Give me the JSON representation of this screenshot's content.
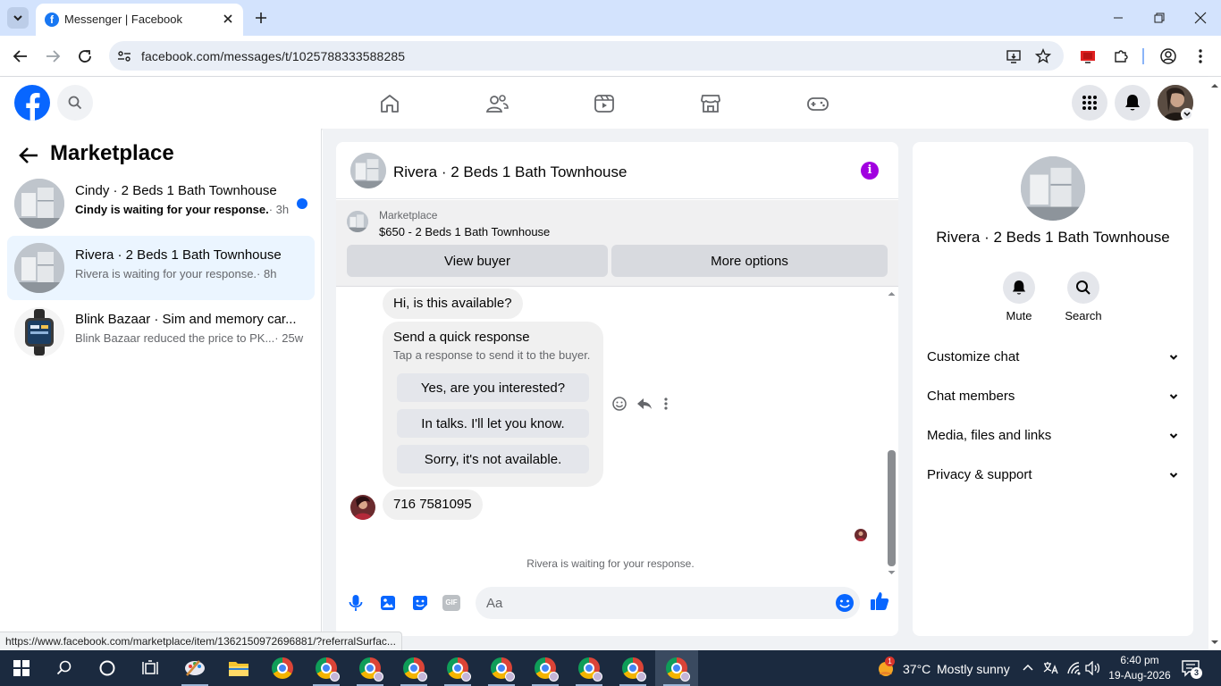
{
  "browser": {
    "tab_title": "Messenger | Facebook",
    "url": "facebook.com/messages/t/1025788333588285",
    "status_link": "https://www.facebook.com/marketplace/item/1362150972696881/?referralSurfac..."
  },
  "sidebar": {
    "title": "Marketplace",
    "conversations": [
      {
        "name": "Cindy · 2 Beds 1 Bath Townhouse",
        "snippet": "Cindy is waiting for your response.",
        "time": "· 3h",
        "unread": true
      },
      {
        "name": "Rivera · 2 Beds 1 Bath Townhouse",
        "snippet": "Rivera is waiting for your response.",
        "time": "· 8h",
        "unread": false,
        "active": true
      },
      {
        "name": "Blink Bazaar · Sim and memory car...",
        "snippet": "Blink Bazaar reduced the price to PK...",
        "time": "· 25w",
        "unread": false
      }
    ]
  },
  "chat": {
    "title": "Rivera · 2 Beds 1 Bath Townhouse",
    "marketplace_label": "Marketplace",
    "listing": "$650 - 2 Beds 1 Bath Townhouse",
    "view_buyer": "View buyer",
    "more_options": "More options",
    "messages": [
      {
        "text": "Hi, is this available?"
      },
      {
        "text": "716 7581095"
      }
    ],
    "quick_response": {
      "title": "Send a quick response",
      "subtitle": "Tap a response to send it to the buyer.",
      "options": [
        "Yes, are you interested?",
        "In talks. I'll let you know.",
        "Sorry, it's not available."
      ]
    },
    "waiting": "Rivera is waiting for your response.",
    "composer_placeholder": "Aa",
    "gif_label": "GIF"
  },
  "info_panel": {
    "name": "Rivera · 2 Beds 1 Bath Townhouse",
    "mute": "Mute",
    "search": "Search",
    "sections": [
      "Customize chat",
      "Chat members",
      "Media, files and links",
      "Privacy & support"
    ]
  },
  "taskbar": {
    "weather_temp": "37°C",
    "weather_desc": "Mostly sunny",
    "weather_badge": "1",
    "time": "6:40 pm",
    "date": "19-Aug-2026",
    "notifications": "3"
  },
  "colors": {
    "facebook_blue": "#0866ff",
    "messenger_purple": "#a100e0",
    "active_row": "#ebf5ff",
    "taskbar": "#1b2a3f"
  }
}
